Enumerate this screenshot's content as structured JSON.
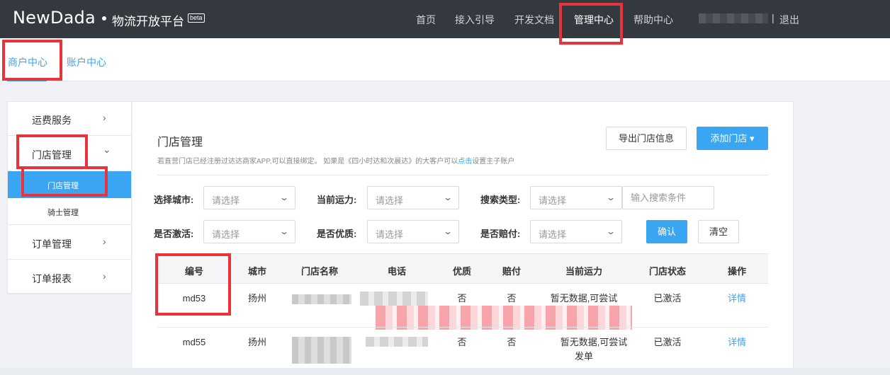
{
  "header": {
    "logo": "NewDada",
    "platform": "物流开放平台",
    "beta": "beta",
    "nav": [
      {
        "label": "首页"
      },
      {
        "label": "接入引导"
      },
      {
        "label": "开发文档"
      },
      {
        "label": "管理中心"
      },
      {
        "label": "帮助中心"
      }
    ],
    "separator": "|",
    "logout": "退出"
  },
  "subnav": {
    "tabs": [
      {
        "label": "商户中心"
      },
      {
        "label": "账户中心"
      }
    ]
  },
  "sidebar": {
    "items": [
      {
        "label": "运费服务",
        "chevron": "›"
      },
      {
        "label": "门店管理",
        "chevron": "⌄"
      },
      {
        "label": "订单管理",
        "chevron": "›"
      },
      {
        "label": "订单报表",
        "chevron": "›"
      }
    ],
    "sub_items": [
      {
        "label": "门店管理"
      },
      {
        "label": "骑士管理"
      }
    ]
  },
  "main": {
    "title": "门店管理",
    "tip_prefix": "若直营门店已经注册过达达商家APP,可以直接绑定。 如果是《四小时达和次晨达》的大客户可以",
    "tip_link": "点击",
    "tip_suffix": "设置主子账户",
    "export_button": "导出门店信息",
    "add_button": "添加门店 ▾",
    "filters": {
      "city_label": "选择城市:",
      "capacity_label": "当前运力:",
      "search_type_label": "搜索类型:",
      "activated_label": "是否激活:",
      "premium_label": "是否优质:",
      "compensation_label": "是否赔付:",
      "select_placeholder": "请选择",
      "search_placeholder": "输入搜索条件",
      "confirm_button": "确认",
      "clear_button": "清空"
    },
    "table": {
      "columns": [
        "编号",
        "城市",
        "门店名称",
        "电话",
        "优质",
        "赔付",
        "当前运力",
        "门店状态",
        "操作"
      ],
      "rows": [
        {
          "id": "md53",
          "city": "扬州",
          "premium": "否",
          "compensation": "否",
          "capacity": "暂无数据,可尝试",
          "status": "已激活",
          "action": "详情"
        },
        {
          "id": "md55",
          "city": "扬州",
          "premium": "否",
          "compensation": "否",
          "capacity_line1": "暂无数据,可尝试",
          "capacity_line2": "发单",
          "status": "已激活",
          "action": "详情"
        }
      ]
    }
  },
  "icons": {
    "select_arrow": "⌄"
  },
  "colors": {
    "topbar": "#34393f",
    "accent": "#3aa5f2",
    "annotation": "#e8323c"
  }
}
